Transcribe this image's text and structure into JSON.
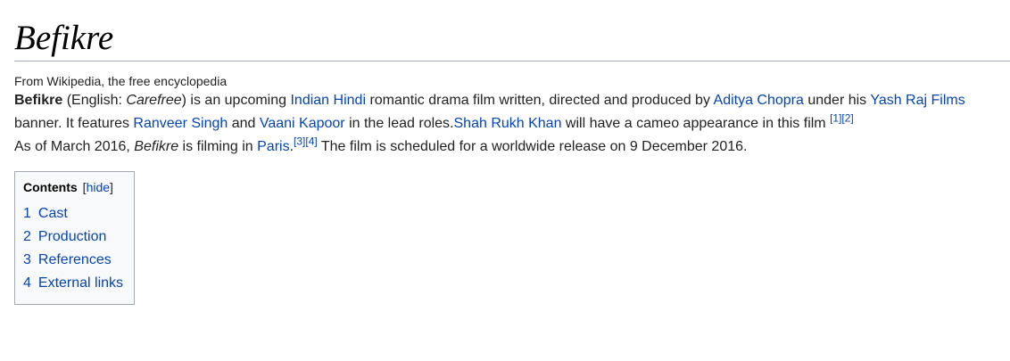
{
  "article": {
    "title": "Befikre",
    "tagline": "From Wikipedia, the free encyclopedia"
  },
  "intro": {
    "p1": {
      "t1": "Befikre",
      "t2": " (English: ",
      "t3": "Carefree",
      "t4": ") is an upcoming ",
      "l1": "Indian",
      "t5": " ",
      "l2": "Hindi",
      "t6": " romantic drama film written, directed and produced by ",
      "l3": "Aditya Chopra",
      "t7": " under his ",
      "l4": "Yash Raj Films",
      "t8": " banner. It features ",
      "l5": "Ranveer Singh",
      "t9": " and ",
      "l6": "Vaani Kapoor",
      "t10": " in the lead roles.",
      "l7": "Shah Rukh Khan",
      "t11": " will have a cameo appearance in this film ",
      "r1": "[1]",
      "r2": "[2]"
    },
    "p2": {
      "t1": "As of March 2016, ",
      "t2": "Befikre",
      "t3": " is filming in ",
      "l1": "Paris",
      "t4": ".",
      "r1": "[3]",
      "r2": "[4]",
      "t5": " The film is scheduled for a worldwide release on 9 December 2016."
    }
  },
  "toc": {
    "title": "Contents",
    "bracket_open": "[",
    "toggle_label": "hide",
    "bracket_close": "]",
    "items": [
      {
        "num": "1",
        "label": "Cast"
      },
      {
        "num": "2",
        "label": "Production"
      },
      {
        "num": "3",
        "label": "References"
      },
      {
        "num": "4",
        "label": "External links"
      }
    ]
  }
}
